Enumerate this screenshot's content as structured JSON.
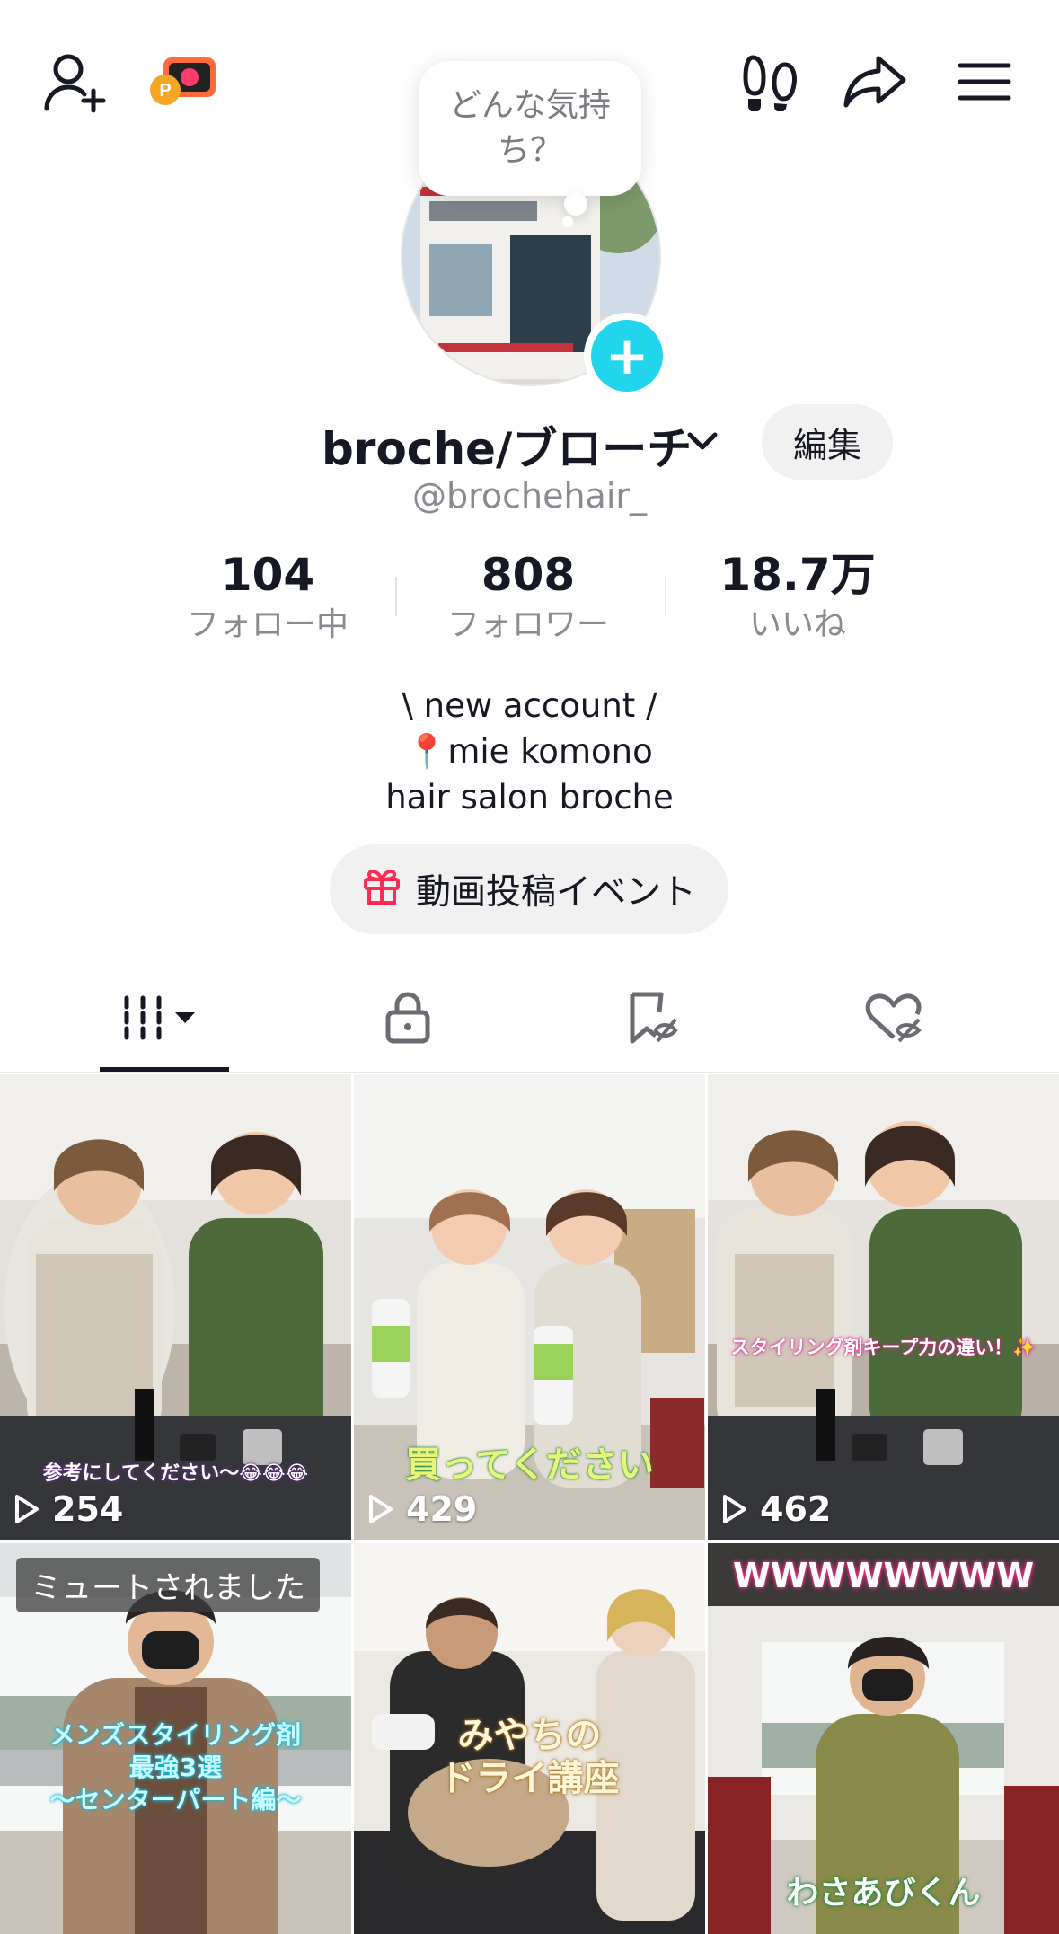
{
  "header": {
    "add_friend_icon": "person-plus-icon",
    "points_icon": "camera-points-icon",
    "footprint_icon": "footprints-icon",
    "share_icon": "share-arrow-icon",
    "menu_icon": "hamburger-icon"
  },
  "mood_bubble": "どんな気持ち？",
  "profile": {
    "avatar_sign": "broche",
    "display_name": "broche/ブローチ",
    "edit_label": "編集",
    "handle": "@brochehair_"
  },
  "stats": [
    {
      "value": "104",
      "label": "フォロー中"
    },
    {
      "value": "808",
      "label": "フォロワー"
    },
    {
      "value": "18.7万",
      "label": "いいね"
    }
  ],
  "bio": [
    "\\ new account /",
    "📍mie komono",
    "hair salon broche"
  ],
  "event_button": "動画投稿イベント",
  "tabs": [
    "videos-grid-icon",
    "lock-icon",
    "saved-hidden-icon",
    "liked-hidden-icon"
  ],
  "videos": [
    {
      "caption": "参考にしてください〜😂😂😂",
      "views": "254"
    },
    {
      "caption": "買ってください",
      "views": "429"
    },
    {
      "caption": "スタイリング剤キープ力の違い！✨",
      "views": "462"
    },
    {
      "badge": "ミュートされました",
      "caption": "メンズスタイリング剤\n最強3選\n〜センターパート編〜"
    },
    {
      "caption": "みやちの\nドライ講座"
    },
    {
      "caption_top": "WWWWWWWW",
      "caption": "わさあびくん"
    }
  ],
  "colors": {
    "accent": "#20d5ec",
    "text": "#161823",
    "muted": "#8a8b91",
    "pill": "#f1f1f2"
  }
}
